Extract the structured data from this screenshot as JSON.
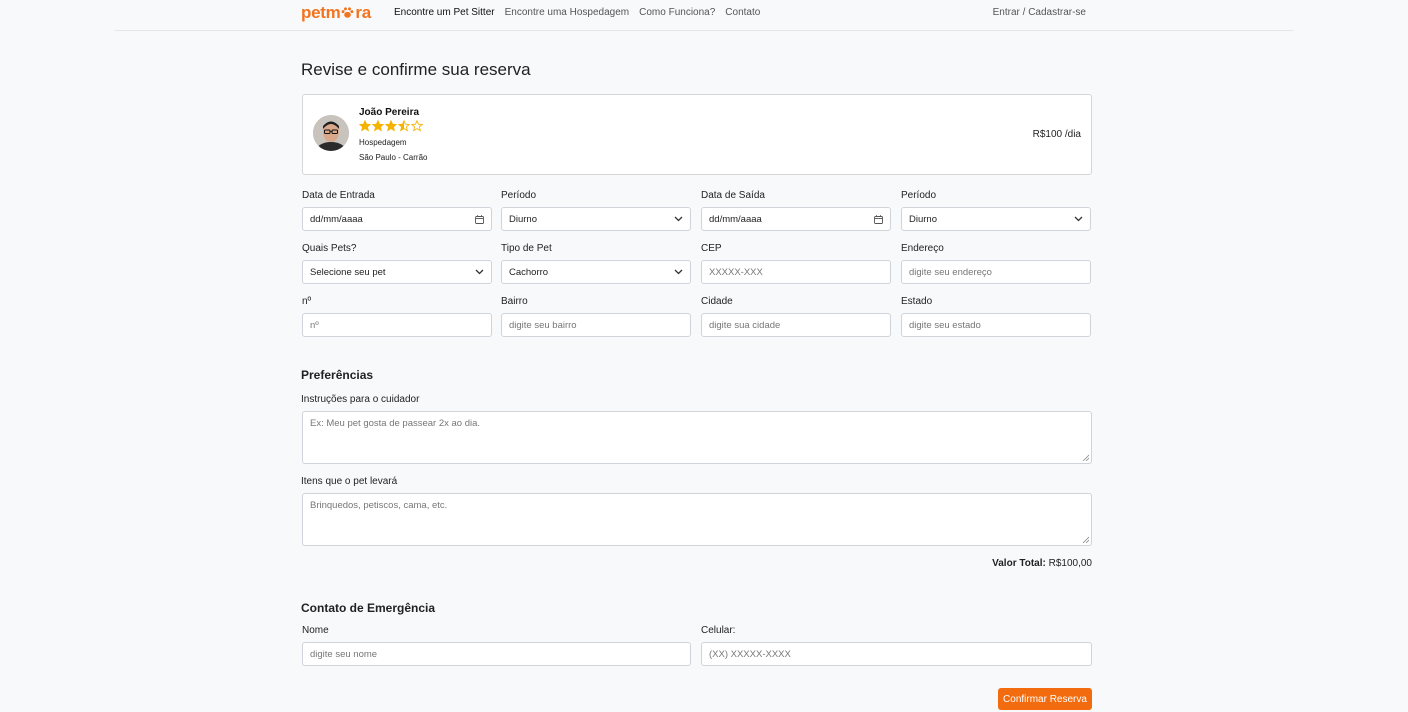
{
  "brand": {
    "logo_left": "petm",
    "logo_right": "ra",
    "accent": "#f27420"
  },
  "nav": {
    "links": [
      "Encontre um Pet Sitter",
      "Encontre uma Hospedagem",
      "Como Funciona?",
      "Contato"
    ],
    "login": "Entrar / Cadastrar-se"
  },
  "page": {
    "title": "Revise e confirme sua reserva"
  },
  "sitter": {
    "name": "João Pereira",
    "rating": 3.5,
    "rating_max": 5,
    "type": "Hospedagem",
    "location": "São Paulo - Carrão",
    "price": "R$100 /dia"
  },
  "form": {
    "checkin": {
      "label": "Data de Entrada",
      "value": "dd/mm/aaaa"
    },
    "checkin_period": {
      "label": "Período",
      "value": "Diurno"
    },
    "checkout": {
      "label": "Data de Saída",
      "value": "dd/mm/aaaa"
    },
    "checkout_period": {
      "label": "Período",
      "value": "Diurno"
    },
    "pets": {
      "label": "Quais Pets?",
      "value": "Selecione seu pet"
    },
    "pet_type": {
      "label": "Tipo de Pet",
      "value": "Cachorro"
    },
    "cep": {
      "label": "CEP",
      "placeholder": "XXXXX-XXX"
    },
    "address": {
      "label": "Endereço",
      "placeholder": "digite seu endereço"
    },
    "number": {
      "label": "nº",
      "placeholder": "nº"
    },
    "district": {
      "label": "Bairro",
      "placeholder": "digite seu bairro"
    },
    "city": {
      "label": "Cidade",
      "placeholder": "digite sua cidade"
    },
    "state": {
      "label": "Estado",
      "placeholder": "digite seu estado"
    }
  },
  "preferences": {
    "title": "Preferências",
    "instructions": {
      "label": "Instruções para o cuidador",
      "placeholder": "Ex: Meu pet gosta de passear 2x ao dia."
    },
    "items": {
      "label": "Itens que o pet levará",
      "placeholder": "Brinquedos, petiscos, cama, etc."
    }
  },
  "total": {
    "label": "Valor Total:",
    "value": "R$100,00"
  },
  "emergency": {
    "title": "Contato de Emergência",
    "name": {
      "label": "Nome",
      "placeholder": "digite seu nome"
    },
    "phone": {
      "label": "Celular:",
      "placeholder": "(XX) XXXXX-XXXX"
    }
  },
  "confirm_label": "Confirmar Reserva"
}
